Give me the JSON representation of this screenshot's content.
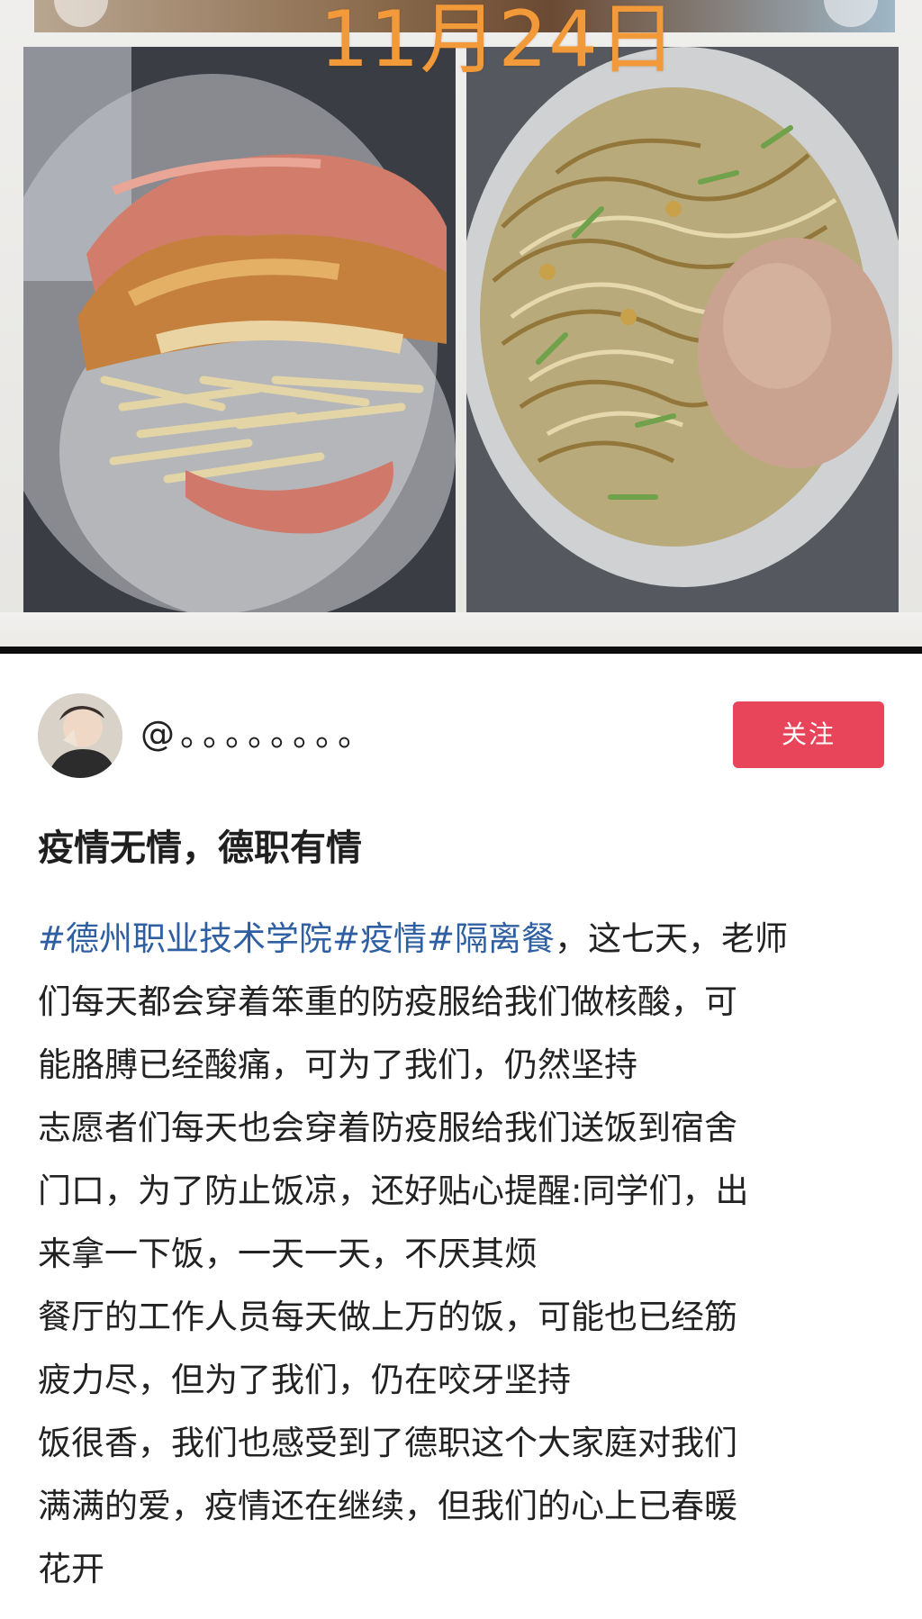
{
  "photo_overlay": {
    "date_text": "11月24日"
  },
  "author": {
    "avatar_icon": "user-avatar",
    "username": "@。。。。。。。。"
  },
  "follow_button_label": "关注",
  "post": {
    "title": "疫情无情，德职有情",
    "hashtags": [
      "#德州职业技术学院",
      "#疫情",
      "#隔离餐"
    ],
    "lines": [
      "，这七天，老师",
      "们每天都会穿着笨重的防疫服给我们做核酸，可",
      "能胳膊已经酸痛，可为了我们，仍然坚持",
      "志愿者们每天也会穿着防疫服给我们送饭到宿舍",
      "门口，为了防止饭凉，还好贴心提醒:同学们，出",
      "来拿一下饭，一天一天，不厌其烦",
      "餐厅的工作人员每天做上万的饭，可能也已经筋",
      "疲力尽，但为了我们，仍在咬牙坚持",
      "饭很香，我们也感受到了德职这个大家庭对我们",
      "满满的爱，疫情还在继续，但我们的心上已春暖",
      "花开"
    ]
  },
  "colors": {
    "accent_follow": "#e8445a",
    "hashtag": "#2f5fa3",
    "date_overlay": "#f29a3a"
  }
}
